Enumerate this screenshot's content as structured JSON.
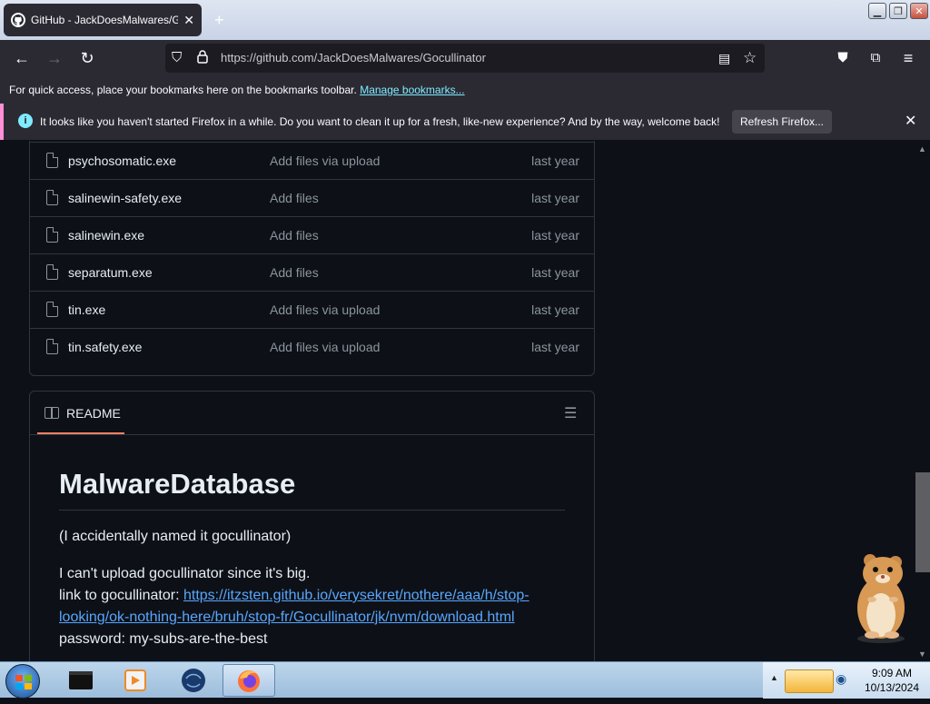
{
  "browser": {
    "tab_title": "GitHub - JackDoesMalwares/Gocullinator",
    "url": "https://github.com/JackDoesMalwares/Gocullinator"
  },
  "bookmarks_bar": {
    "text": "For quick access, place your bookmarks here on the bookmarks toolbar.",
    "link": "Manage bookmarks..."
  },
  "notification": {
    "message": "It looks like you haven't started Firefox in a while. Do you want to clean it up for a fresh, like-new experience? And by the way, welcome back!",
    "button": "Refresh Firefox..."
  },
  "files": [
    {
      "name": "psychosomatic.exe",
      "commit": "Add files via upload",
      "age": "last year"
    },
    {
      "name": "salinewin-safety.exe",
      "commit": "Add files",
      "age": "last year"
    },
    {
      "name": "salinewin.exe",
      "commit": "Add files",
      "age": "last year"
    },
    {
      "name": "separatum.exe",
      "commit": "Add files",
      "age": "last year"
    },
    {
      "name": "tin.exe",
      "commit": "Add files via upload",
      "age": "last year"
    },
    {
      "name": "tin.safety.exe",
      "commit": "Add files via upload",
      "age": "last year"
    }
  ],
  "readme": {
    "tab_label": "README",
    "heading": "MalwareDatabase",
    "p1": "(I accidentally named it gocullinator)",
    "p2_line1": "I can't upload gocullinator since it's big.",
    "p2_link_prefix": "link to gocullinator: ",
    "p2_link_part1": "https://itzsten.github.io/verysekret/nothere/aaa/h/stop-",
    "p2_link_part2": "looking/ok-nothing-here/bruh/stop-fr/Gocullinator/jk/nvm/download.html",
    "p2_password": "password: my-subs-are-the-best"
  },
  "taskbar": {
    "time": "9:09 AM",
    "date": "10/13/2024"
  }
}
